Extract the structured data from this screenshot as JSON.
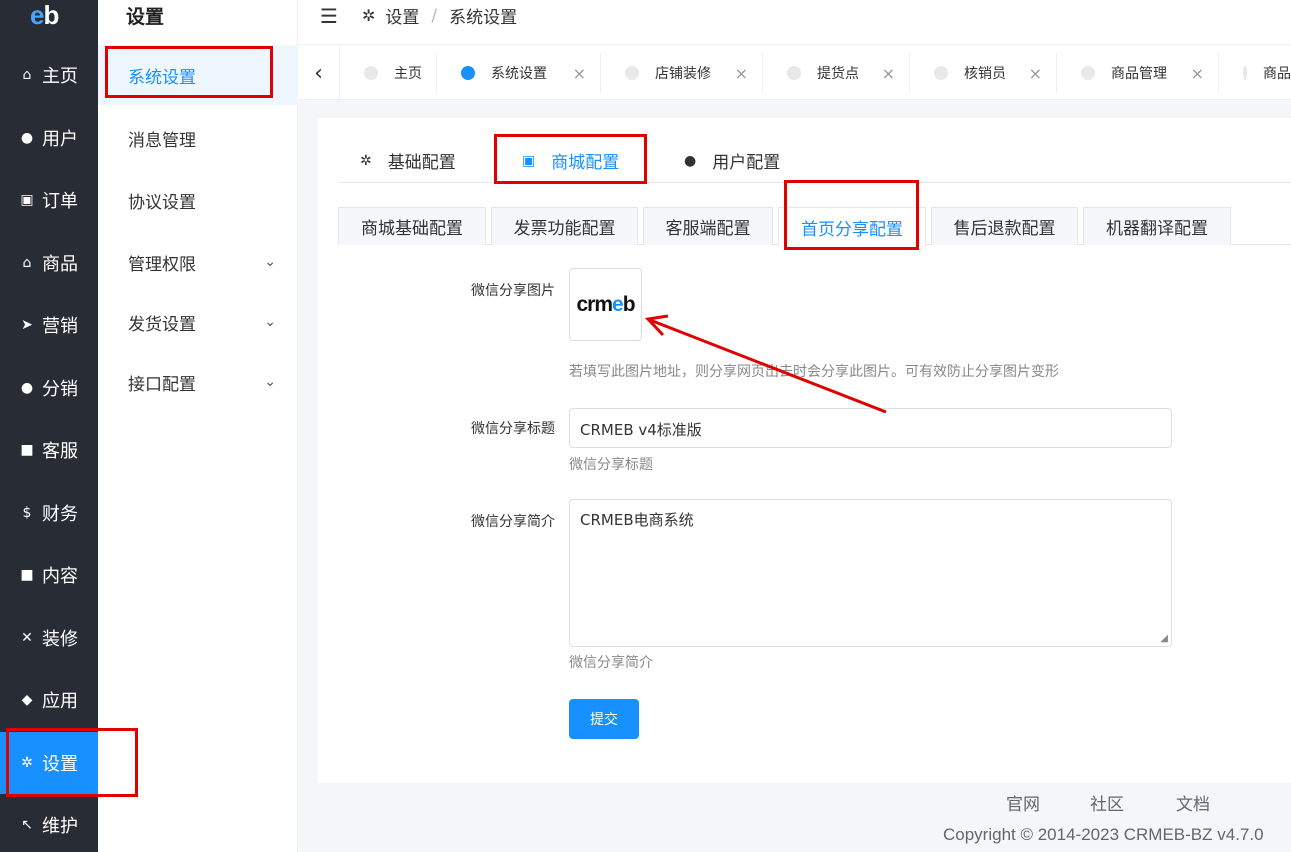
{
  "logo": {
    "e": "e",
    "b": "b"
  },
  "nav": [
    {
      "icon": "home-icon",
      "glyph": "⌂",
      "label": "主页"
    },
    {
      "icon": "user-icon",
      "glyph": "●",
      "label": "用户"
    },
    {
      "icon": "cart-icon",
      "glyph": "🛒",
      "label": "订单"
    },
    {
      "icon": "basket-icon",
      "glyph": "⌂",
      "label": "商品"
    },
    {
      "icon": "send-icon",
      "glyph": "➤",
      "label": "营销"
    },
    {
      "icon": "group-icon",
      "glyph": "●",
      "label": "分销"
    },
    {
      "icon": "chat-icon",
      "glyph": "■",
      "label": "客服"
    },
    {
      "icon": "dollar-icon",
      "glyph": "$",
      "label": "财务"
    },
    {
      "icon": "book-icon",
      "glyph": "■",
      "label": "内容"
    },
    {
      "icon": "tools-icon",
      "glyph": "✕",
      "label": "装修"
    },
    {
      "icon": "cube-icon",
      "glyph": "◆",
      "label": "应用"
    },
    {
      "icon": "gear-icon",
      "glyph": "✲",
      "label": "设置"
    },
    {
      "icon": "hammer-icon",
      "glyph": "↖",
      "label": "维护"
    }
  ],
  "submenu": {
    "title": "设置",
    "items": [
      {
        "label": "系统设置",
        "expandable": false
      },
      {
        "label": "消息管理",
        "expandable": false
      },
      {
        "label": "协议设置",
        "expandable": false
      },
      {
        "label": "管理权限",
        "expandable": true
      },
      {
        "label": "发货设置",
        "expandable": true
      },
      {
        "label": "接口配置",
        "expandable": true
      }
    ]
  },
  "header": {
    "collapse": "☰",
    "crumb_root": "设置",
    "crumb_sep": "/",
    "crumb_current": "系统设置"
  },
  "tabs": [
    {
      "label": "主页",
      "closable": false,
      "active": false
    },
    {
      "label": "系统设置",
      "closable": true,
      "active": true
    },
    {
      "label": "店铺装修",
      "closable": true,
      "active": false
    },
    {
      "label": "提货点",
      "closable": true,
      "active": false
    },
    {
      "label": "核销员",
      "closable": true,
      "active": false
    },
    {
      "label": "商品管理",
      "closable": true,
      "active": false
    },
    {
      "label": "商品",
      "closable": false,
      "active": false
    }
  ],
  "top_tabs": [
    {
      "icon": "gear-icon",
      "glyph": "✲",
      "label": "基础配置"
    },
    {
      "icon": "cart-icon",
      "glyph": "🛒",
      "label": "商城配置"
    },
    {
      "icon": "user-circle-icon",
      "glyph": "●",
      "label": "用户配置"
    }
  ],
  "sub_tabs": [
    "商城基础配置",
    "发票功能配置",
    "客服端配置",
    "首页分享配置",
    "售后退款配置",
    "机器翻译配置"
  ],
  "form": {
    "share_image_label": "微信分享图片",
    "share_image_brand": {
      "a": "crm",
      "b": "e",
      "c": "b"
    },
    "share_image_hint": "若填写此图片地址，则分享网页出去时会分享此图片。可有效防止分享图片变形",
    "share_title_label": "微信分享标题",
    "share_title_value": "CRMEB v4标准版",
    "share_title_hint": "微信分享标题",
    "share_desc_label": "微信分享简介",
    "share_desc_value": "CRMEB电商系统",
    "share_desc_hint": "微信分享简介",
    "submit": "提交"
  },
  "footer": {
    "links": [
      "官网",
      "社区",
      "文档"
    ],
    "copyright": "Copyright © 2014-2023 CRMEB-BZ v4.7.0"
  },
  "colors": {
    "accent": "#1890ff",
    "nav_bg": "#282c34",
    "annotation": "#e00000"
  }
}
